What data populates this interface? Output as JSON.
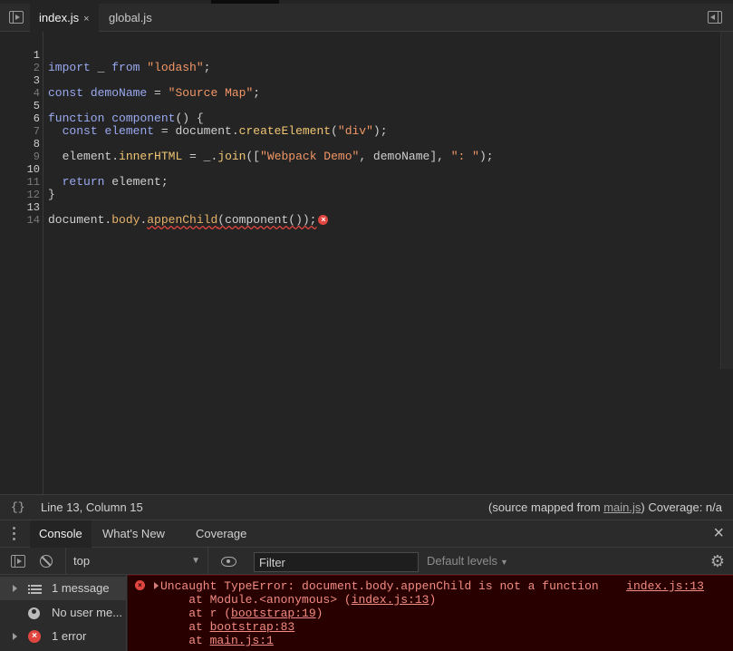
{
  "tabs": [
    {
      "label": "index.js",
      "close": "×"
    },
    {
      "label": "global.js"
    }
  ],
  "code_lines": [
    {
      "n": "1"
    },
    {
      "n": "2"
    },
    {
      "n": "3"
    },
    {
      "n": "4"
    },
    {
      "n": "5"
    },
    {
      "n": "6"
    },
    {
      "n": "7"
    },
    {
      "n": "8"
    },
    {
      "n": "9"
    },
    {
      "n": "10"
    },
    {
      "n": "11"
    },
    {
      "n": "12"
    },
    {
      "n": "13"
    },
    {
      "n": "14"
    }
  ],
  "code": {
    "l1": {
      "kw1": "import",
      "mid": " _ ",
      "kw2": "from",
      "sp": " ",
      "str": "\"lodash\"",
      "end": ";"
    },
    "l3": {
      "kw": "const",
      "sp": " ",
      "var": "demoName",
      "eq": " = ",
      "str": "\"Source Map\"",
      "end": ";"
    },
    "l5": {
      "kw": "function",
      "sp": " ",
      "var": "component",
      "end": "() {"
    },
    "l6": {
      "indent": "  ",
      "kw": "const",
      "sp": " ",
      "var": "element",
      "eq": " = ",
      "obj": "document.",
      "prop": "createElement",
      "open": "(",
      "str": "\"div\"",
      "end": ");"
    },
    "l8": {
      "indent": "  ",
      "obj": "element.",
      "prop": "innerHTML",
      "eq": " = ",
      "obj2": "_.",
      "prop2": "join",
      "open": "([",
      "str1": "\"Webpack Demo\"",
      "mid": ", demoName], ",
      "str2": "\": \"",
      "end": ");"
    },
    "l10": {
      "indent": "  ",
      "kw": "return",
      "end": " element;"
    },
    "l11": {
      "end": "}"
    },
    "l13": {
      "obj": "document.",
      "prop": "body",
      "dot": ".",
      "prop2": "appenChild",
      "end": "(component());",
      "err": "×"
    }
  },
  "status": {
    "braces": "{}",
    "cursor": "Line 13, Column 15",
    "mapped_prefix": "(source mapped from ",
    "mapped_link": "main.js",
    "mapped_suffix": ") Coverage: n/a"
  },
  "drawer": {
    "tabs": [
      "Console",
      "What's New",
      "Coverage"
    ],
    "close": "×"
  },
  "console_toolbar": {
    "context": "top",
    "context_caret": "▼",
    "filter_placeholder": "Filter",
    "levels": "Default levels",
    "levels_caret": "▼",
    "settings": "⚙"
  },
  "console_sidebar": [
    {
      "label": "1 message"
    },
    {
      "label": "No user me..."
    },
    {
      "label": "1 error",
      "icon": "×"
    }
  ],
  "console_message": {
    "icon": "×",
    "line1": "Uncaught TypeError: document.body.appenChild is not a function",
    "source": "index.js:13",
    "frames": [
      {
        "prefix": "    at Module.<anonymous> (",
        "link": "index.js:13",
        "suffix": ")"
      },
      {
        "prefix": "    at r (",
        "link": "bootstrap:19",
        "suffix": ")"
      },
      {
        "prefix": "    at ",
        "link": "bootstrap:83",
        "suffix": ""
      },
      {
        "prefix": "    at ",
        "link": "main.js:1",
        "suffix": ""
      }
    ]
  },
  "colors": {
    "error": "#e0463f",
    "error_text": "#f28b82",
    "error_bg": "#290000",
    "keyword": "#9aa9f0",
    "string": "#f29766",
    "property": "#f0c674"
  }
}
